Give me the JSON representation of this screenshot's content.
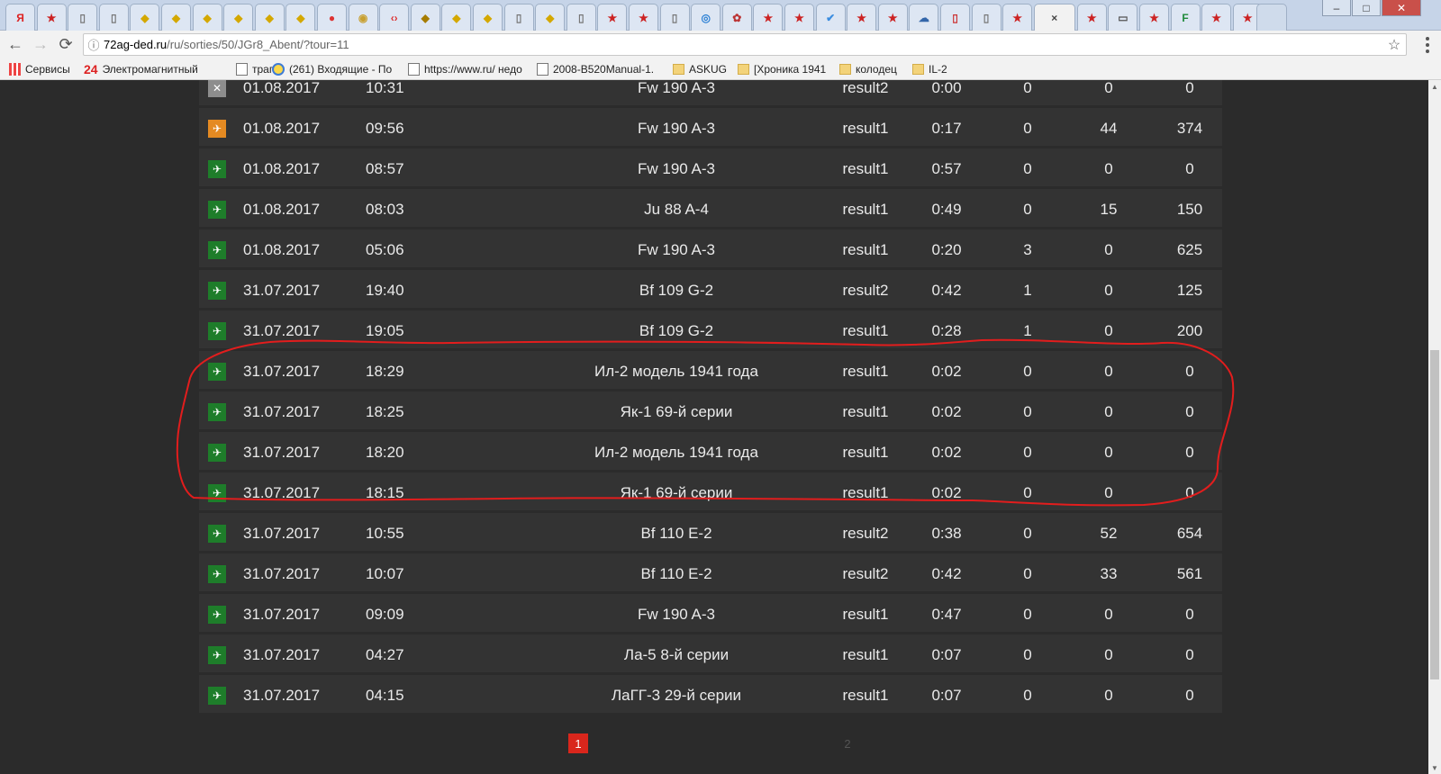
{
  "browser": {
    "url_host": "72ag-ded.ru",
    "url_path": "/ru/sorties/50/JGr8_Abent/?tour=11",
    "tabs": [
      {
        "icon": "Я",
        "color": "#d22"
      },
      {
        "icon": "★",
        "color": "#c22"
      },
      {
        "icon": "▯",
        "color": "#777"
      },
      {
        "icon": "▯",
        "color": "#777"
      },
      {
        "icon": "◆",
        "color": "#d4a800"
      },
      {
        "icon": "◆",
        "color": "#d4a800"
      },
      {
        "icon": "◆",
        "color": "#d4a800"
      },
      {
        "icon": "◆",
        "color": "#d4a800"
      },
      {
        "icon": "◆",
        "color": "#d4a800"
      },
      {
        "icon": "◆",
        "color": "#d4a800"
      },
      {
        "icon": "●",
        "color": "#d33"
      },
      {
        "icon": "◉",
        "color": "#c8a030"
      },
      {
        "icon": "‹›",
        "color": "#d33"
      },
      {
        "icon": "◆",
        "color": "#a67c00"
      },
      {
        "icon": "◆",
        "color": "#d4a800"
      },
      {
        "icon": "◆",
        "color": "#d4a800"
      },
      {
        "icon": "▯",
        "color": "#777"
      },
      {
        "icon": "◆",
        "color": "#d4a800"
      },
      {
        "icon": "▯",
        "color": "#777"
      },
      {
        "icon": "★",
        "color": "#c22"
      },
      {
        "icon": "★",
        "color": "#c22"
      },
      {
        "icon": "▯",
        "color": "#777"
      },
      {
        "icon": "◎",
        "color": "#2a7fd4"
      },
      {
        "icon": "✿",
        "color": "#b33"
      },
      {
        "icon": "★",
        "color": "#c22"
      },
      {
        "icon": "★",
        "color": "#c22"
      },
      {
        "icon": "✔",
        "color": "#3b8de0"
      },
      {
        "icon": "★",
        "color": "#c22"
      },
      {
        "icon": "★",
        "color": "#c22"
      },
      {
        "icon": "☁",
        "color": "#3366aa"
      },
      {
        "icon": "▯",
        "color": "#c33"
      },
      {
        "icon": "▯",
        "color": "#777"
      },
      {
        "icon": "★",
        "color": "#c22"
      },
      {
        "icon": "×",
        "color": "#444",
        "active": true
      },
      {
        "icon": "★",
        "color": "#c22"
      },
      {
        "icon": "▭",
        "color": "#555"
      },
      {
        "icon": "★",
        "color": "#c22"
      },
      {
        "icon": "F",
        "color": "#1f8a3a"
      },
      {
        "icon": "★",
        "color": "#c22"
      },
      {
        "icon": "★",
        "color": "#c22"
      }
    ],
    "window_buttons": [
      "–",
      "□",
      "✕"
    ],
    "bookmarks": [
      {
        "label": "Сервисы",
        "icon": "apps"
      },
      {
        "label": "Электромагнитный",
        "icon": "n24",
        "prefix": "24"
      },
      {
        "label": "трап",
        "icon": "doc"
      },
      {
        "label": "(261) Входящие - По",
        "icon": "mail"
      },
      {
        "label": "https://www.ru/ недо",
        "icon": "doc"
      },
      {
        "label": "2008-B520Manual-1.",
        "icon": "doc"
      },
      {
        "label": "ASKUG",
        "icon": "folder"
      },
      {
        "label": "[Хроника 1941",
        "icon": "folder"
      },
      {
        "label": "колодец",
        "icon": "folder"
      },
      {
        "label": "IL-2",
        "icon": "folder"
      }
    ]
  },
  "sorties": [
    {
      "icon": "gray",
      "date": "01.08.2017",
      "time": "10:31",
      "aircraft": "Fw 190 A-3",
      "result": "result2",
      "duration": "0:00",
      "a": "0",
      "b": "0",
      "c": "0"
    },
    {
      "icon": "orange",
      "date": "01.08.2017",
      "time": "09:56",
      "aircraft": "Fw 190 A-3",
      "result": "result1",
      "duration": "0:17",
      "a": "0",
      "b": "44",
      "c": "374"
    },
    {
      "icon": "green",
      "date": "01.08.2017",
      "time": "08:57",
      "aircraft": "Fw 190 A-3",
      "result": "result1",
      "duration": "0:57",
      "a": "0",
      "b": "0",
      "c": "0"
    },
    {
      "icon": "green",
      "date": "01.08.2017",
      "time": "08:03",
      "aircraft": "Ju 88 A-4",
      "result": "result1",
      "duration": "0:49",
      "a": "0",
      "b": "15",
      "c": "150"
    },
    {
      "icon": "green",
      "date": "01.08.2017",
      "time": "05:06",
      "aircraft": "Fw 190 A-3",
      "result": "result1",
      "duration": "0:20",
      "a": "3",
      "b": "0",
      "c": "625"
    },
    {
      "icon": "green",
      "date": "31.07.2017",
      "time": "19:40",
      "aircraft": "Bf 109 G-2",
      "result": "result2",
      "duration": "0:42",
      "a": "1",
      "b": "0",
      "c": "125"
    },
    {
      "icon": "green",
      "date": "31.07.2017",
      "time": "19:05",
      "aircraft": "Bf 109 G-2",
      "result": "result1",
      "duration": "0:28",
      "a": "1",
      "b": "0",
      "c": "200"
    },
    {
      "icon": "green",
      "date": "31.07.2017",
      "time": "18:29",
      "aircraft": "Ил-2 модель 1941 года",
      "result": "result1",
      "duration": "0:02",
      "a": "0",
      "b": "0",
      "c": "0"
    },
    {
      "icon": "green",
      "date": "31.07.2017",
      "time": "18:25",
      "aircraft": "Як-1 69-й серии",
      "result": "result1",
      "duration": "0:02",
      "a": "0",
      "b": "0",
      "c": "0"
    },
    {
      "icon": "green",
      "date": "31.07.2017",
      "time": "18:20",
      "aircraft": "Ил-2 модель 1941 года",
      "result": "result1",
      "duration": "0:02",
      "a": "0",
      "b": "0",
      "c": "0"
    },
    {
      "icon": "green",
      "date": "31.07.2017",
      "time": "18:15",
      "aircraft": "Як-1 69-й серии",
      "result": "result1",
      "duration": "0:02",
      "a": "0",
      "b": "0",
      "c": "0"
    },
    {
      "icon": "green",
      "date": "31.07.2017",
      "time": "10:55",
      "aircraft": "Bf 110 E-2",
      "result": "result2",
      "duration": "0:38",
      "a": "0",
      "b": "52",
      "c": "654"
    },
    {
      "icon": "green",
      "date": "31.07.2017",
      "time": "10:07",
      "aircraft": "Bf 110 E-2",
      "result": "result2",
      "duration": "0:42",
      "a": "0",
      "b": "33",
      "c": "561"
    },
    {
      "icon": "green",
      "date": "31.07.2017",
      "time": "09:09",
      "aircraft": "Fw 190 A-3",
      "result": "result1",
      "duration": "0:47",
      "a": "0",
      "b": "0",
      "c": "0"
    },
    {
      "icon": "green",
      "date": "31.07.2017",
      "time": "04:27",
      "aircraft": "Ла-5 8-й серии",
      "result": "result1",
      "duration": "0:07",
      "a": "0",
      "b": "0",
      "c": "0"
    },
    {
      "icon": "green",
      "date": "31.07.2017",
      "time": "04:15",
      "aircraft": "ЛаГГ-3 29-й серии",
      "result": "result1",
      "duration": "0:07",
      "a": "0",
      "b": "0",
      "c": "0"
    }
  ],
  "pagination": {
    "current": "1",
    "next": "2"
  },
  "colors": {
    "annotation": "#e21d1d",
    "accent": "#d9261c"
  }
}
